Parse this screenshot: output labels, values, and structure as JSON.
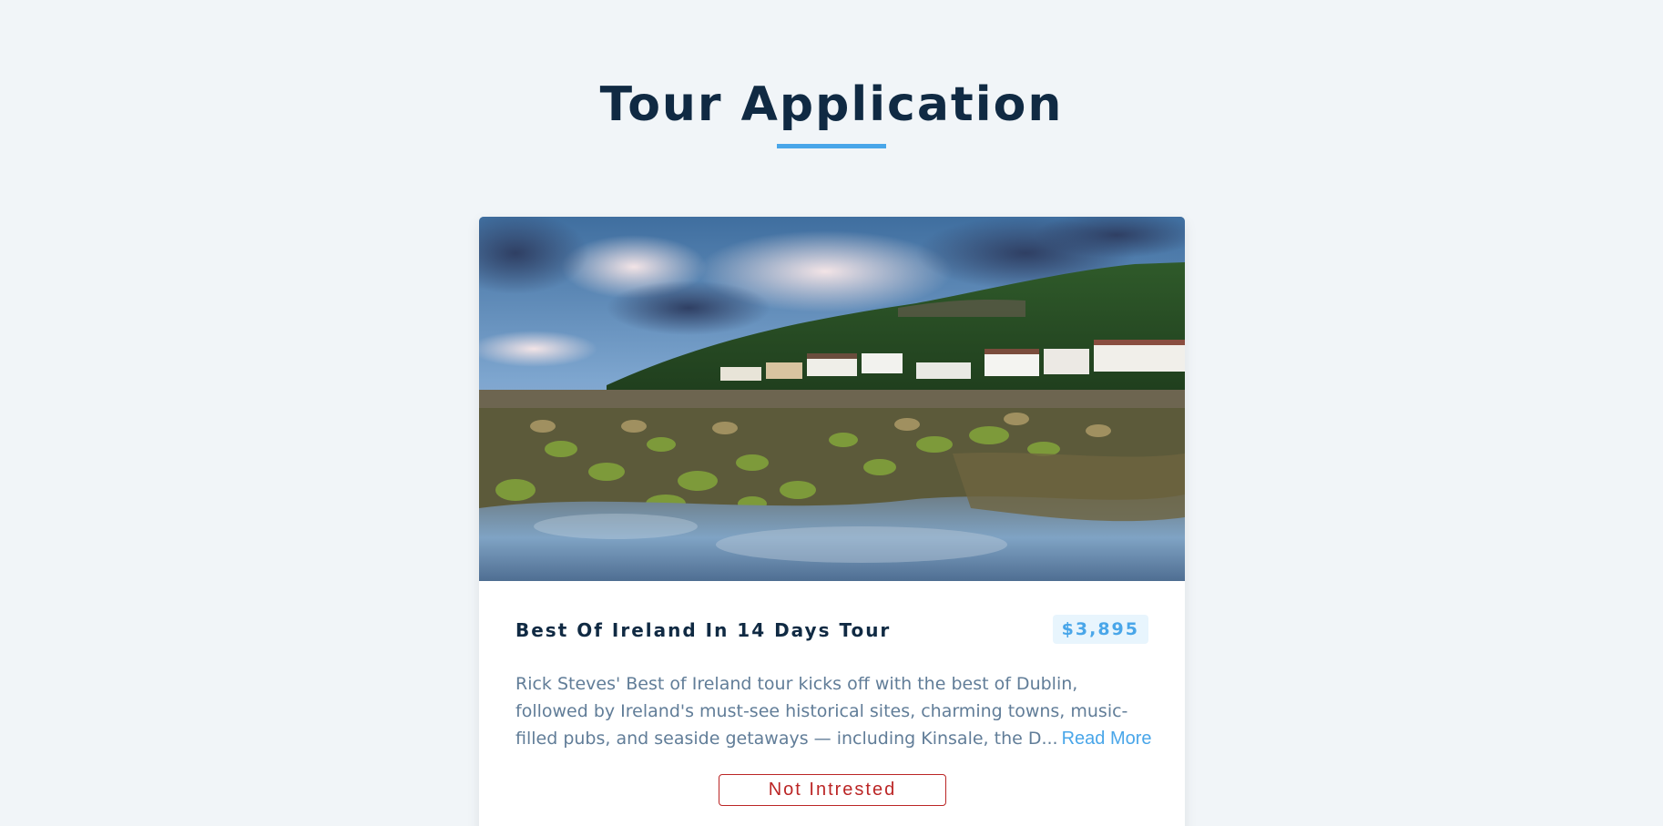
{
  "page": {
    "title": "Tour Application"
  },
  "tour": {
    "image_alt": "Coastal village with mossy rocks at low tide under a cloudy sky",
    "name": "Best Of Ireland In 14 Days Tour",
    "price": "$3,895",
    "description": "Rick Steves' Best of Ireland tour kicks off with the best of Dublin, followed by Ireland's must-see historical sites, charming towns, music-filled pubs, and seaside getaways — including Kinsale, the D...",
    "read_more_label": "Read More",
    "not_interested_label": "Not Intrested"
  },
  "colors": {
    "background": "#f1f5f8",
    "title": "#102a43",
    "accent": "#49a6e9",
    "danger": "#bb2525",
    "text_muted": "#617d98"
  }
}
